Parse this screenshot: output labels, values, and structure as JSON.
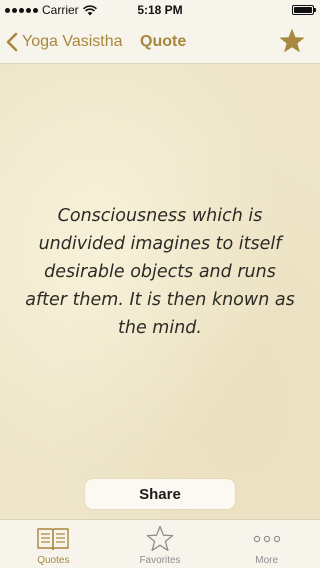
{
  "status_bar": {
    "carrier": "Carrier",
    "time": "5:18 PM",
    "battery_level": 1.0
  },
  "nav": {
    "back_label": "Yoga Vasistha",
    "title": "Quote",
    "back_icon": "chevron-left-icon",
    "favorite_icon": "star-filled-icon",
    "accent_color": "#a8873f"
  },
  "quote": {
    "text": "Consciousness which is undivided imagines to itself desirable objects and runs after them. It is then known as the mind."
  },
  "share": {
    "label": "Share"
  },
  "tabs": [
    {
      "label": "Quotes",
      "icon": "book-icon",
      "active": true
    },
    {
      "label": "Favorites",
      "icon": "star-outline-icon",
      "active": false
    },
    {
      "label": "More",
      "icon": "more-icon",
      "active": false
    }
  ]
}
